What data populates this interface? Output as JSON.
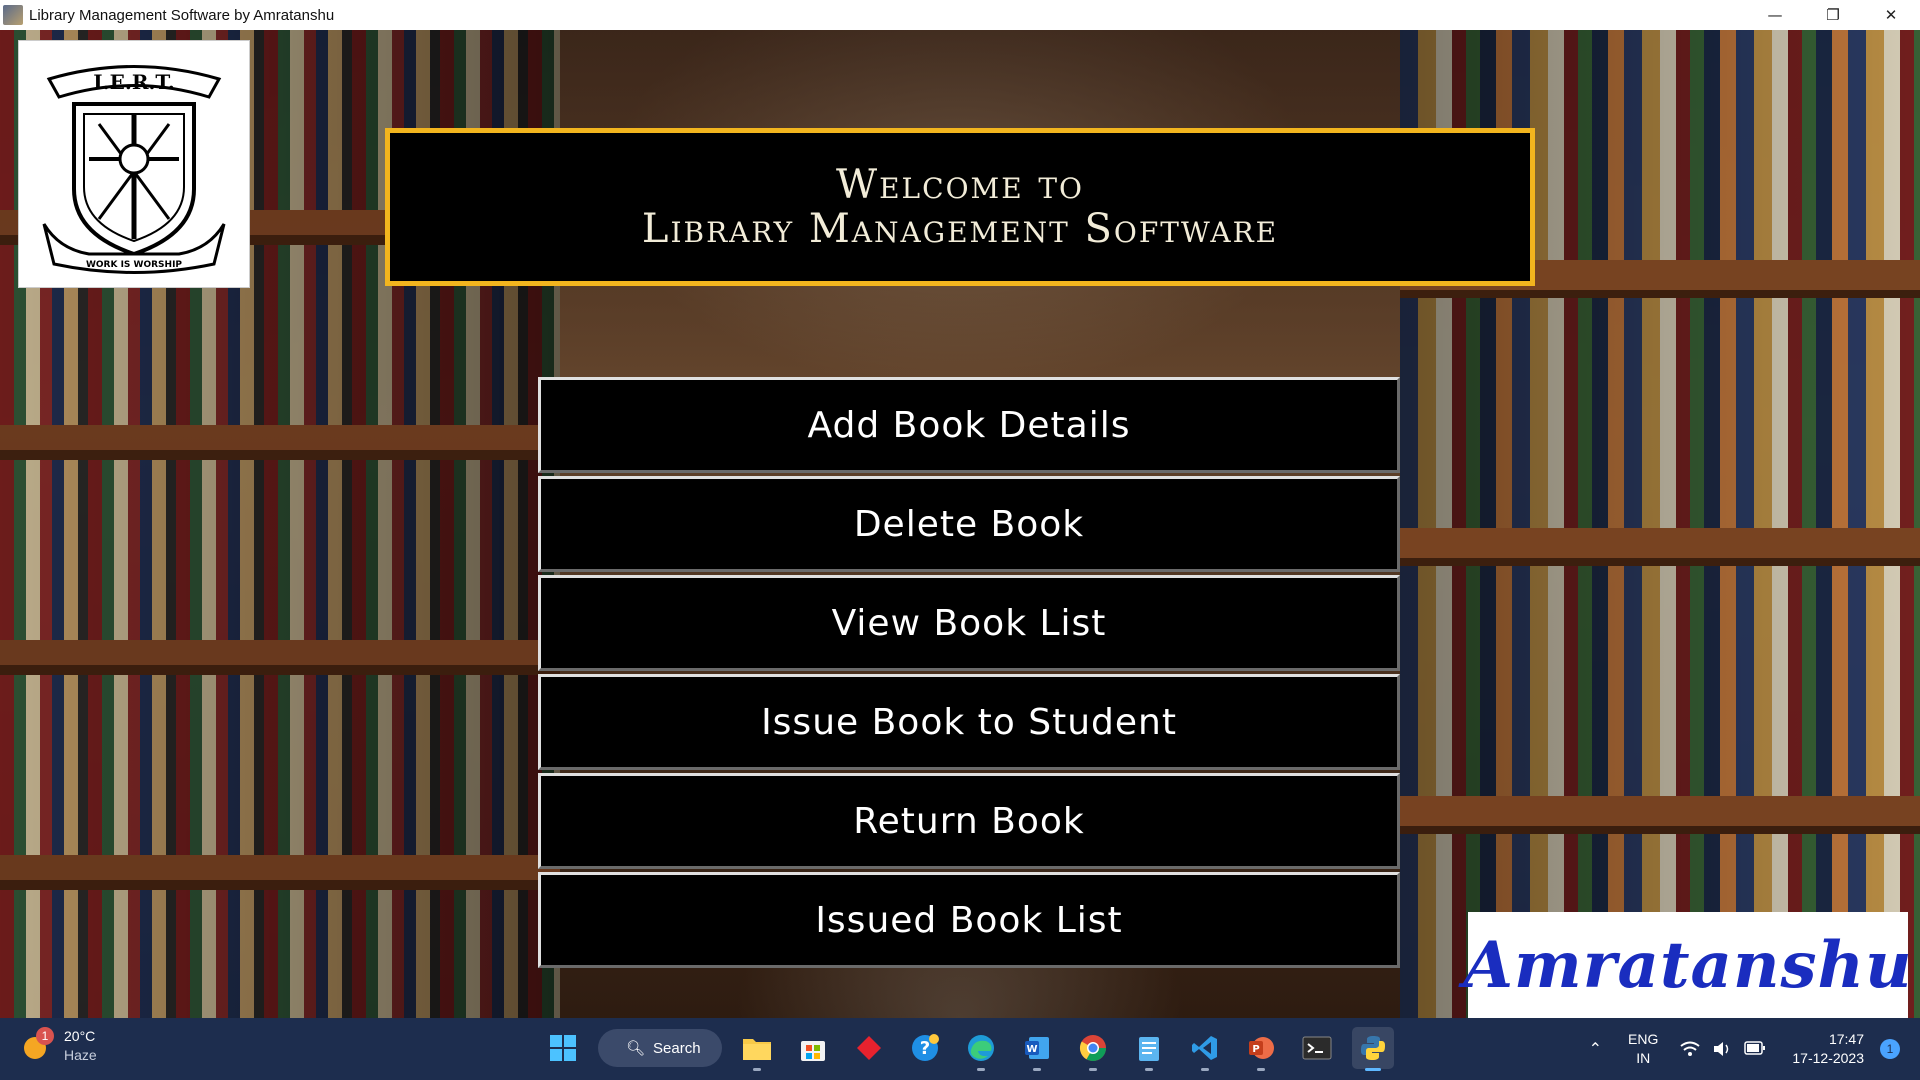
{
  "window": {
    "title": "Library Management Software by Amratanshu",
    "minimize": "—",
    "maximize": "❐",
    "close": "✕"
  },
  "logo": {
    "banner_text": "I.E.R.T.",
    "motto": "WORK IS WORSHIP"
  },
  "welcome": {
    "line1": "Welcome to",
    "line2": "Library Management Software"
  },
  "menu": {
    "items": [
      {
        "label": "Add Book Details"
      },
      {
        "label": "Delete Book"
      },
      {
        "label": "View Book List"
      },
      {
        "label": "Issue Book to Student"
      },
      {
        "label": "Return Book"
      },
      {
        "label": "Issued Book List"
      }
    ]
  },
  "signature": "Amratanshu",
  "taskbar": {
    "weather": {
      "temp": "20°C",
      "condition": "Haze",
      "badge": "1"
    },
    "search_label": "Search",
    "lang_top": "ENG",
    "lang_bottom": "IN",
    "time": "17:47",
    "date": "17-12-2023",
    "notifications": "1",
    "apps": [
      "windows-start-icon",
      "file-explorer-icon",
      "microsoft-store-icon",
      "diamond-app-icon",
      "help-icon",
      "edge-icon",
      "word-icon",
      "chrome-icon",
      "notepad-icon",
      "vscode-icon",
      "powerpoint-icon",
      "terminal-icon",
      "python-icon"
    ]
  }
}
